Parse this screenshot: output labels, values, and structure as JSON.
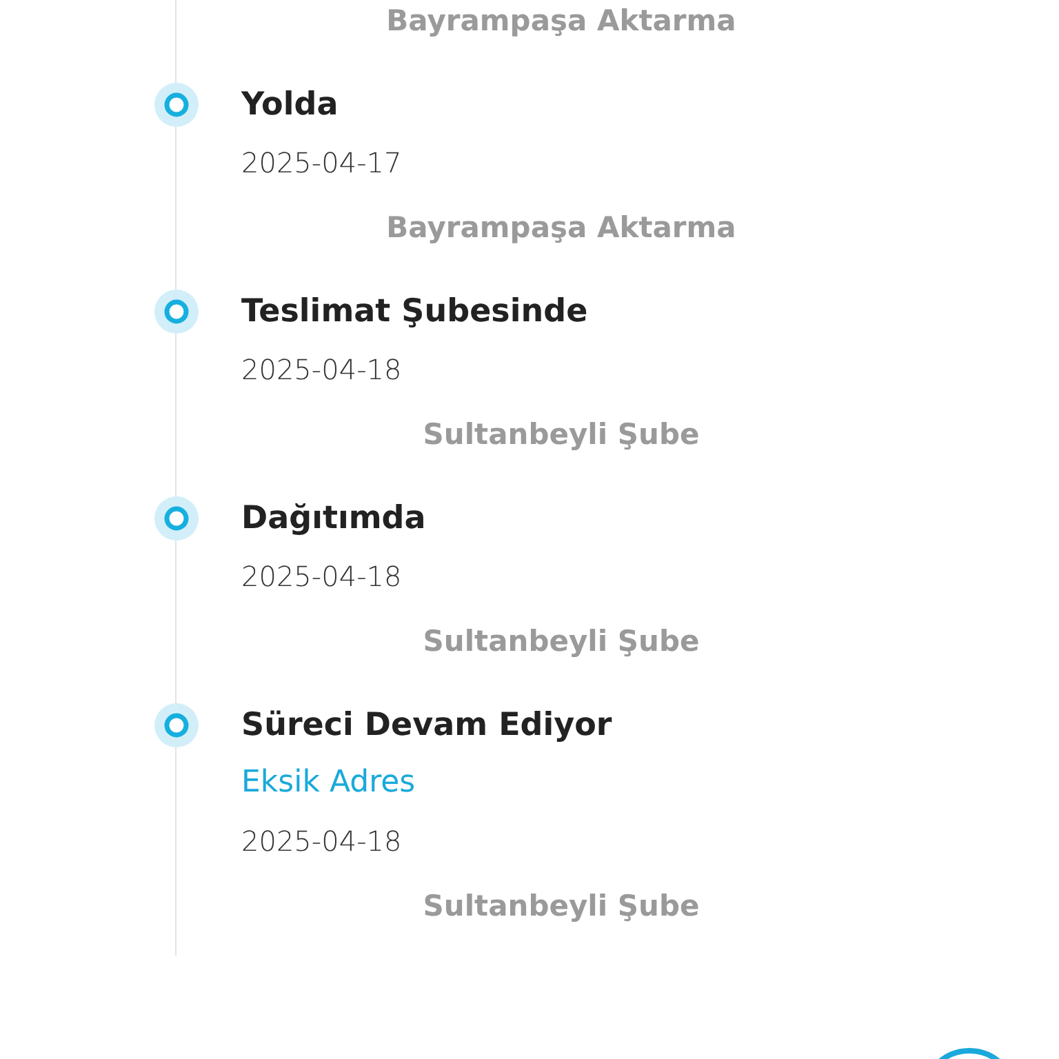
{
  "previous_location": "Bayrampaşa Aktarma",
  "events": [
    {
      "title": "Yolda",
      "date": "2025-04-17",
      "location": "Bayrampaşa Aktarma"
    },
    {
      "title": "Teslimat Şubesinde",
      "date": "2025-04-18",
      "location": "Sultanbeyli Şube"
    },
    {
      "title": "Dağıtımda",
      "date": "2025-04-18",
      "location": "Sultanbeyli Şube"
    },
    {
      "title": "Süreci Devam Ediyor",
      "note": "Eksik Adres",
      "date": "2025-04-18",
      "location": "Sultanbeyli Şube"
    }
  ]
}
